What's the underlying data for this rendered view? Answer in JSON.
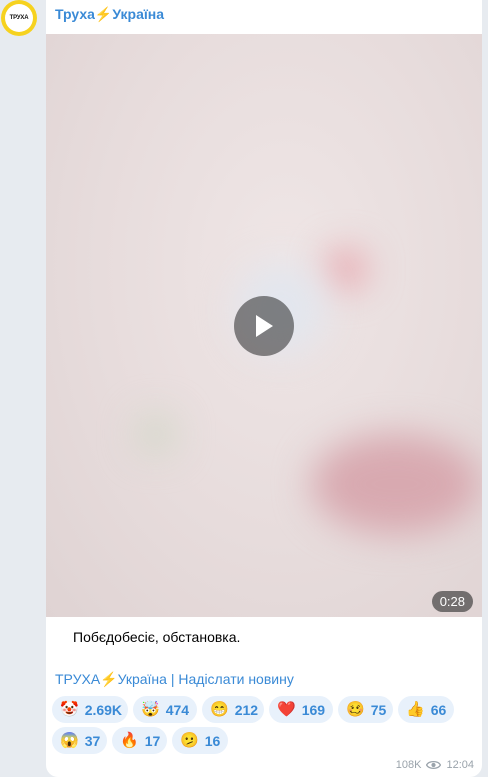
{
  "channel": {
    "name": "Труха⚡Україна",
    "avatar_text": "ТРУХА",
    "accent_color": "#3a8ad6",
    "avatar_color": "#f6d21f"
  },
  "video": {
    "duration": "0:28",
    "play_icon": "play-icon"
  },
  "caption": "Побєдобесіє, обстановка.",
  "footer": {
    "channel_link": "ТРУХА⚡Україна",
    "separator": " | ",
    "submit_link": "Надіслати новину"
  },
  "reactions": [
    {
      "emoji": "🤡",
      "count": "2.69K"
    },
    {
      "emoji": "🤯",
      "count": "474"
    },
    {
      "emoji": "😁",
      "count": "212"
    },
    {
      "emoji": "❤️",
      "count": "169"
    },
    {
      "emoji": "🥴",
      "count": "75"
    },
    {
      "emoji": "👍",
      "count": "66"
    },
    {
      "emoji": "😱",
      "count": "37"
    },
    {
      "emoji": "🔥",
      "count": "17"
    },
    {
      "emoji": "🫤",
      "count": "16"
    }
  ],
  "meta": {
    "views": "108K",
    "time": "12:04",
    "views_icon": "eye-icon"
  }
}
